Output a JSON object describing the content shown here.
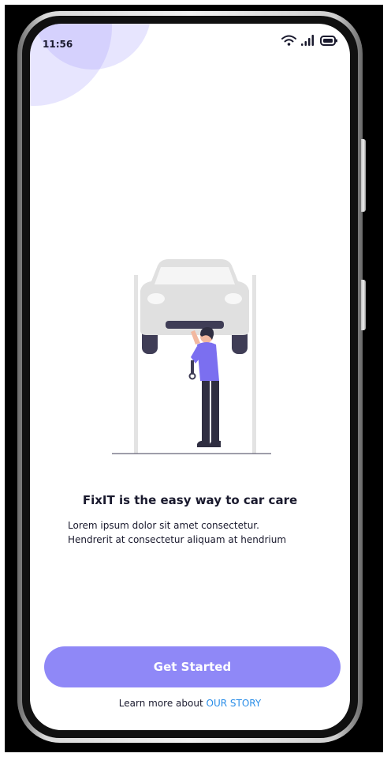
{
  "status_bar": {
    "time": "11:56",
    "icons": [
      "wifi-icon",
      "signal-icon",
      "battery-icon"
    ]
  },
  "onboarding": {
    "illustration": "mechanic-under-car-icon",
    "headline": "FixIT is the easy way to car care",
    "body_line_1": "Lorem ipsum dolor sit amet consectetur.",
    "body_line_2": "Hendrerit at consectetur aliquam at hendrium",
    "cta_label": "Get Started",
    "learn_more_prefix": "Learn more about",
    "learn_more_link": "OUR STORY"
  },
  "colors": {
    "accent": "#8f88f7",
    "link": "#2b8ee8",
    "text": "#1a1a2e",
    "figure_shirt": "#7b6ff0"
  }
}
